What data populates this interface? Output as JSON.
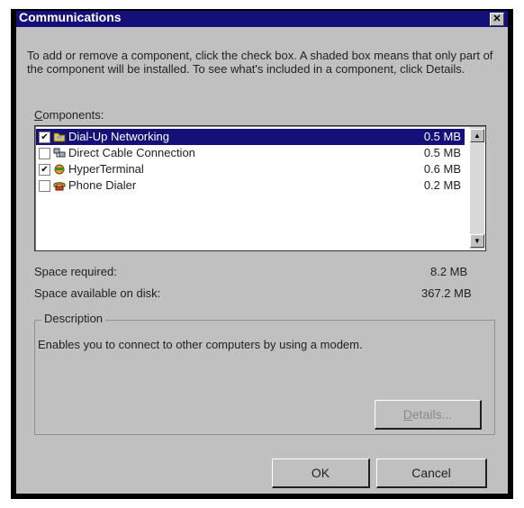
{
  "window": {
    "title": "Communications",
    "close": "✕"
  },
  "instructions": "To add or remove a component, click the check box. A shaded box means that only part of the component will be installed. To see what's included in a component, click Details.",
  "components": {
    "label_first": "C",
    "label_rest": "omponents:",
    "items": [
      {
        "name": "Dial-Up Networking",
        "size": "0.5 MB",
        "checked": true,
        "selected": true,
        "icon": "dial-up-networking-icon"
      },
      {
        "name": "Direct Cable Connection",
        "size": "0.5 MB",
        "checked": false,
        "selected": false,
        "icon": "direct-cable-icon"
      },
      {
        "name": "HyperTerminal",
        "size": "0.6 MB",
        "checked": true,
        "selected": false,
        "icon": "hyperterminal-icon"
      },
      {
        "name": "Phone Dialer",
        "size": "0.2 MB",
        "checked": false,
        "selected": false,
        "icon": "phone-dialer-icon"
      }
    ]
  },
  "space": {
    "required_label": "Space required:",
    "required_value": "8.2 MB",
    "available_label": "Space available on disk:",
    "available_value": "367.2 MB"
  },
  "description": {
    "label": "Description",
    "text": "Enables you to connect to other computers by using a modem."
  },
  "buttons": {
    "details_first": "D",
    "details_rest": "etails...",
    "ok": "OK",
    "cancel": "Cancel"
  },
  "colors": {
    "titlebar": "#14107a",
    "face": "#c0c0c0",
    "selection": "#14107a"
  }
}
